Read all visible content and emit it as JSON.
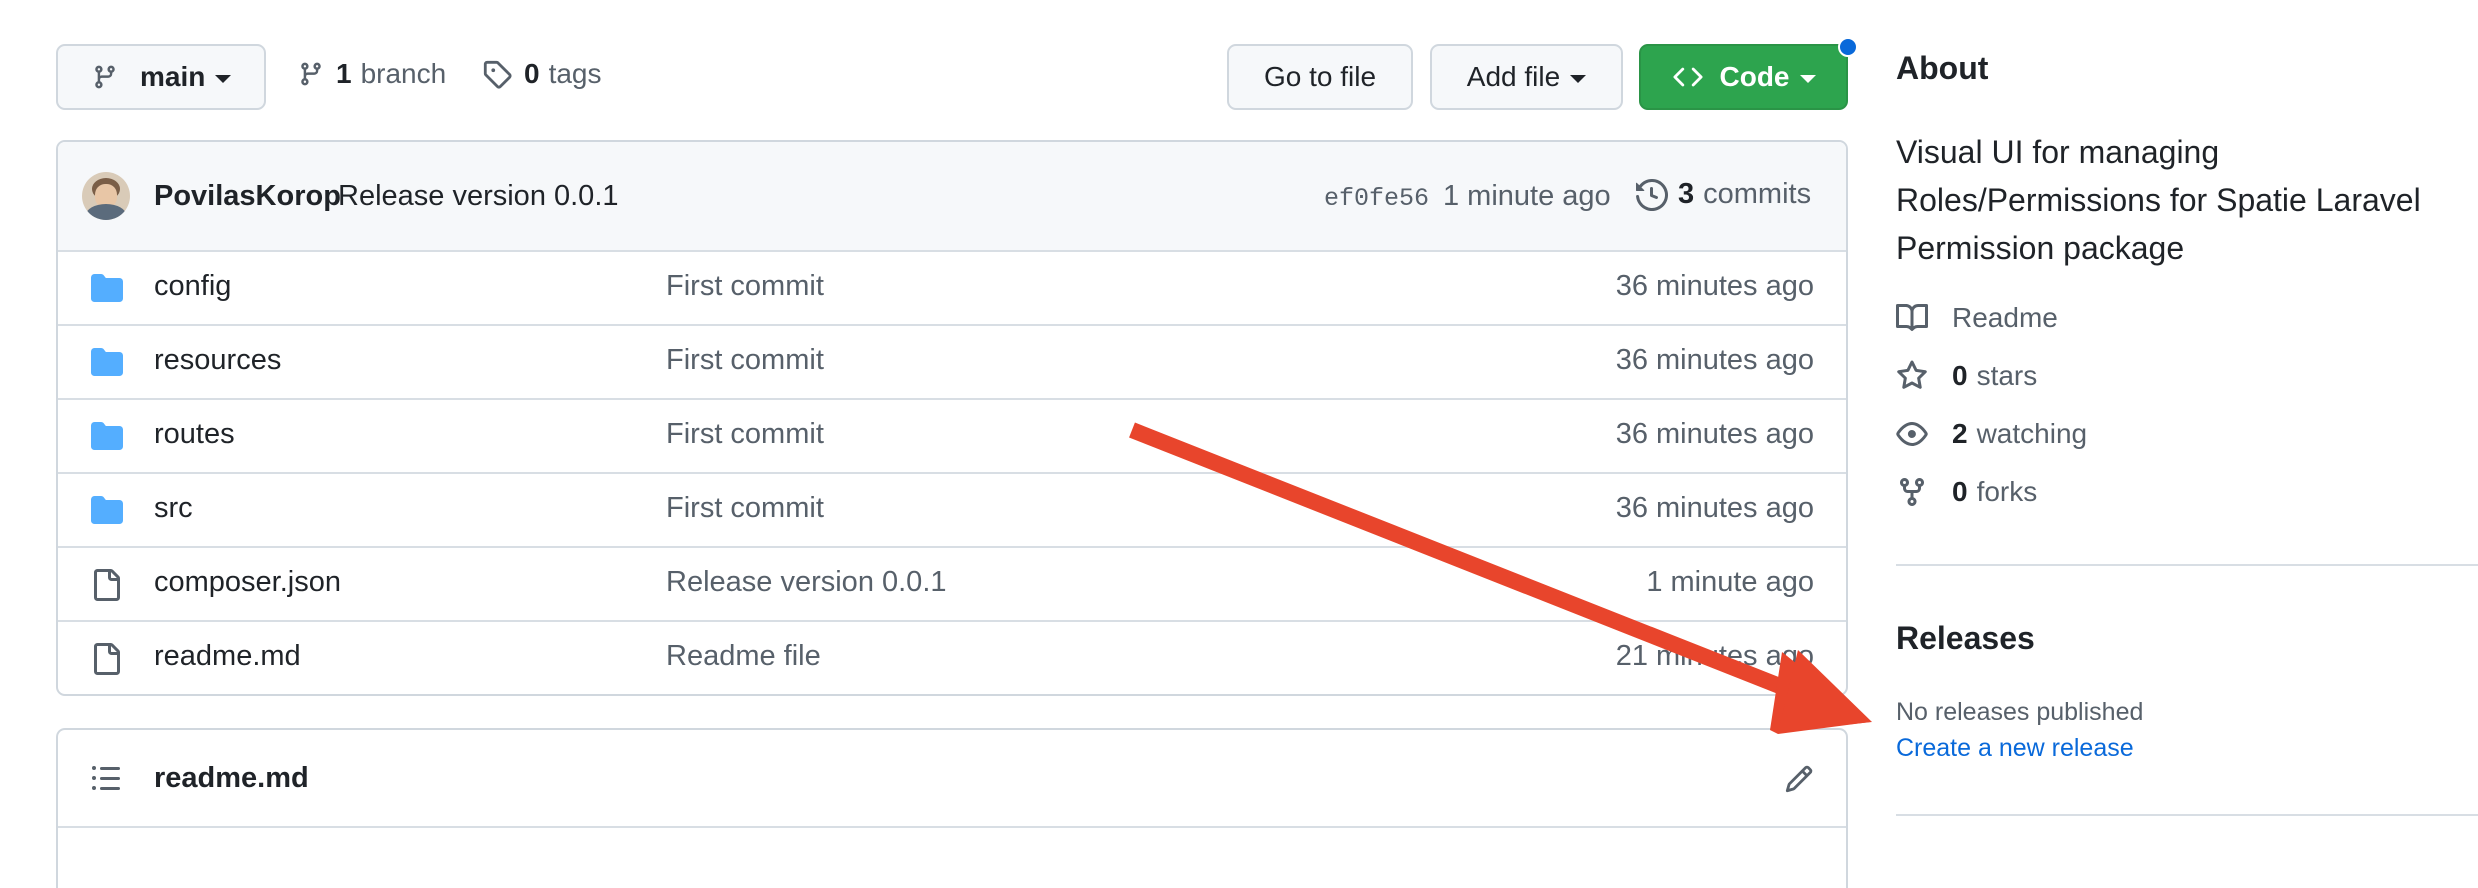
{
  "toolbar": {
    "branch": "main",
    "branches_count": "1",
    "branches_label": "branch",
    "tags_count": "0",
    "tags_label": "tags",
    "go_to_file": "Go to file",
    "add_file": "Add file",
    "code": "Code"
  },
  "commit_bar": {
    "author": "PovilasKorop",
    "message": "Release version 0.0.1",
    "sha": "ef0fe56",
    "time": "1 minute ago",
    "commits_count": "3",
    "commits_label": "commits"
  },
  "files": [
    {
      "type": "folder",
      "name": "config",
      "message": "First commit",
      "time": "36 minutes ago"
    },
    {
      "type": "folder",
      "name": "resources",
      "message": "First commit",
      "time": "36 minutes ago"
    },
    {
      "type": "folder",
      "name": "routes",
      "message": "First commit",
      "time": "36 minutes ago"
    },
    {
      "type": "folder",
      "name": "src",
      "message": "First commit",
      "time": "36 minutes ago"
    },
    {
      "type": "file",
      "name": "composer.json",
      "message": "Release version 0.0.1",
      "time": "1 minute ago"
    },
    {
      "type": "file",
      "name": "readme.md",
      "message": "Readme file",
      "time": "21 minutes ago"
    }
  ],
  "readme": {
    "title": "readme.md"
  },
  "about": {
    "heading": "About",
    "description_lines": [
      "Visual UI for managing",
      "Roles/Permissions for Spatie Laravel",
      "Permission package"
    ],
    "readme_label": "Readme",
    "stars_count": "0",
    "stars_label": "stars",
    "watching_count": "2",
    "watching_label": "watching",
    "forks_count": "0",
    "forks_label": "forks"
  },
  "releases": {
    "heading": "Releases",
    "none_text": "No releases published",
    "create_link": "Create a new release"
  },
  "colors": {
    "accent_blue": "#0969da",
    "green_button": "#2da44e",
    "folder_icon": "#54aeff",
    "annotation_arrow": "#e8452c"
  }
}
